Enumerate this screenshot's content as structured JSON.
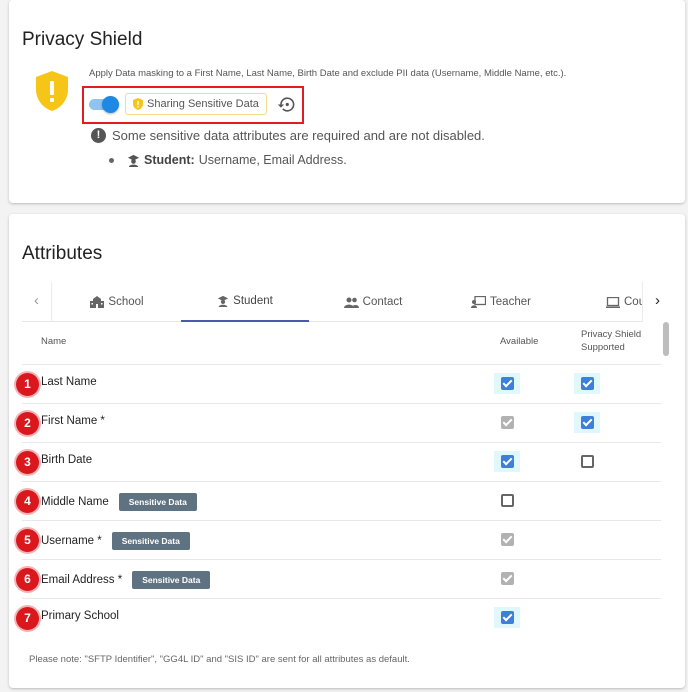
{
  "privacy": {
    "title": "Privacy Shield",
    "description": "Apply Data masking to a First Name, Last Name, Birth Date and exclude PII data (Username, Middle Name, etc.).",
    "toggle_on": true,
    "chip_label": "Sharing Sensitive Data",
    "warning": "Some sensitive data attributes are required and are not disabled.",
    "student_label": "Student:",
    "student_fields": "Username, Email Address."
  },
  "attributes": {
    "title": "Attributes",
    "tabs": [
      {
        "label": "School",
        "icon": "school-icon",
        "active": false
      },
      {
        "label": "Student",
        "icon": "student-icon",
        "active": true
      },
      {
        "label": "Contact",
        "icon": "contact-icon",
        "active": false
      },
      {
        "label": "Teacher",
        "icon": "teacher-icon",
        "active": false
      },
      {
        "label": "Cou",
        "icon": "course-icon",
        "active": false
      }
    ],
    "columns": {
      "name": "Name",
      "available": "Available",
      "shield": "Privacy Shield Supported"
    },
    "rows": [
      {
        "num": "1",
        "name": "Last Name",
        "badge": "",
        "available": "checked",
        "shield": "checked"
      },
      {
        "num": "2",
        "name": "First Name *",
        "badge": "",
        "available": "disabled",
        "shield": "checked"
      },
      {
        "num": "3",
        "name": "Birth Date",
        "badge": "",
        "available": "checked",
        "shield": "unchecked"
      },
      {
        "num": "4",
        "name": "Middle Name",
        "badge": "Sensitive Data",
        "available": "unchecked",
        "shield": "none"
      },
      {
        "num": "5",
        "name": "Username *",
        "badge": "Sensitive Data",
        "available": "disabled",
        "shield": "none"
      },
      {
        "num": "6",
        "name": "Email Address *",
        "badge": "Sensitive Data",
        "available": "disabled",
        "shield": "none"
      },
      {
        "num": "7",
        "name": "Primary School",
        "badge": "",
        "available": "checked",
        "shield": "none"
      }
    ],
    "note": "Please note: \"SFTP Identifier\", \"GG4L ID\" and \"SIS ID\" are sent for all attributes as default."
  },
  "colors": {
    "accent": "#1e88e5",
    "shield_yellow": "#f5c518",
    "highlight_red": "#e31b23",
    "badge_bg": "#5f7282",
    "tab_underline": "#4a5aa8"
  }
}
